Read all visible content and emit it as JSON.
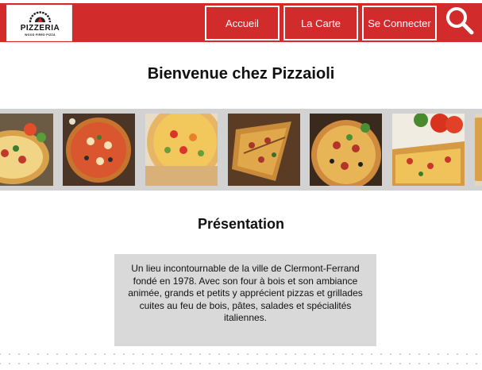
{
  "header": {
    "logo": {
      "main_text": "PIZZERIA",
      "sub_text": "WOOD FIRED PIZZA"
    },
    "nav": {
      "home_label": "Accueil",
      "menu_label": "La Carte",
      "login_label": "Se Connecter"
    },
    "search_icon": "magnifier-icon"
  },
  "main": {
    "title": "Bienvenue chez Pizzaioli",
    "gallery": {
      "items": [
        "pizza-photo",
        "pizza-photo",
        "pizza-photo",
        "pizza-photo",
        "pizza-photo",
        "pizza-photo"
      ]
    },
    "presentation": {
      "title": "Présentation",
      "text": "Un lieu incontournable de la ville de Clermont-Ferrand fondé en 1978. Avec son four à bois et son ambiance animée, grands et petits y apprécient pizzas et grillades cuites au feu de bois, pâtes, salades et spécialités italiennes."
    }
  },
  "colors": {
    "brand_red": "#d12b2b",
    "gallery_bg": "#d2d2d2",
    "card_bg": "#d9d9d9"
  }
}
